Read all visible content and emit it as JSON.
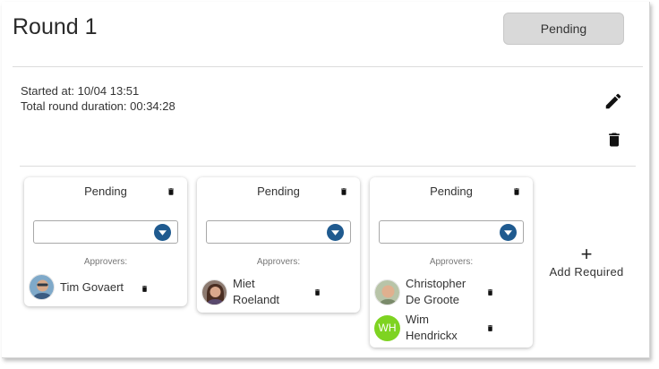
{
  "round": {
    "title": "Round 1",
    "status": "Pending",
    "started_at": "Started at: 10/04 13:51",
    "duration": "Total round duration: 00:34:28"
  },
  "cards": [
    {
      "status": "Pending",
      "select_value": "",
      "approvers_label": "Approvers:",
      "approvers": [
        {
          "name": "Tim Govaert",
          "avatar": "photo"
        }
      ]
    },
    {
      "status": "Pending",
      "select_value": "",
      "approvers_label": "Approvers:",
      "approvers": [
        {
          "name": "Miet Roelandt",
          "avatar": "photo"
        }
      ]
    },
    {
      "status": "Pending",
      "select_value": "",
      "approvers_label": "Approvers:",
      "approvers": [
        {
          "name": "Christopher De Groote",
          "avatar": "photo"
        },
        {
          "name": "Wim Hendrickx",
          "avatar": "initials",
          "initials": "WH",
          "color": "#7ed321"
        }
      ]
    }
  ],
  "add_required": {
    "symbol": "+",
    "label": "Add Required"
  },
  "colors": {
    "accent": "#1f5a8f",
    "status_bg": "#d9d9d9",
    "initials_bg": "#7ed321"
  },
  "icons": [
    "pencil-icon",
    "trash-icon",
    "chevron-down-icon",
    "plus-icon"
  ]
}
